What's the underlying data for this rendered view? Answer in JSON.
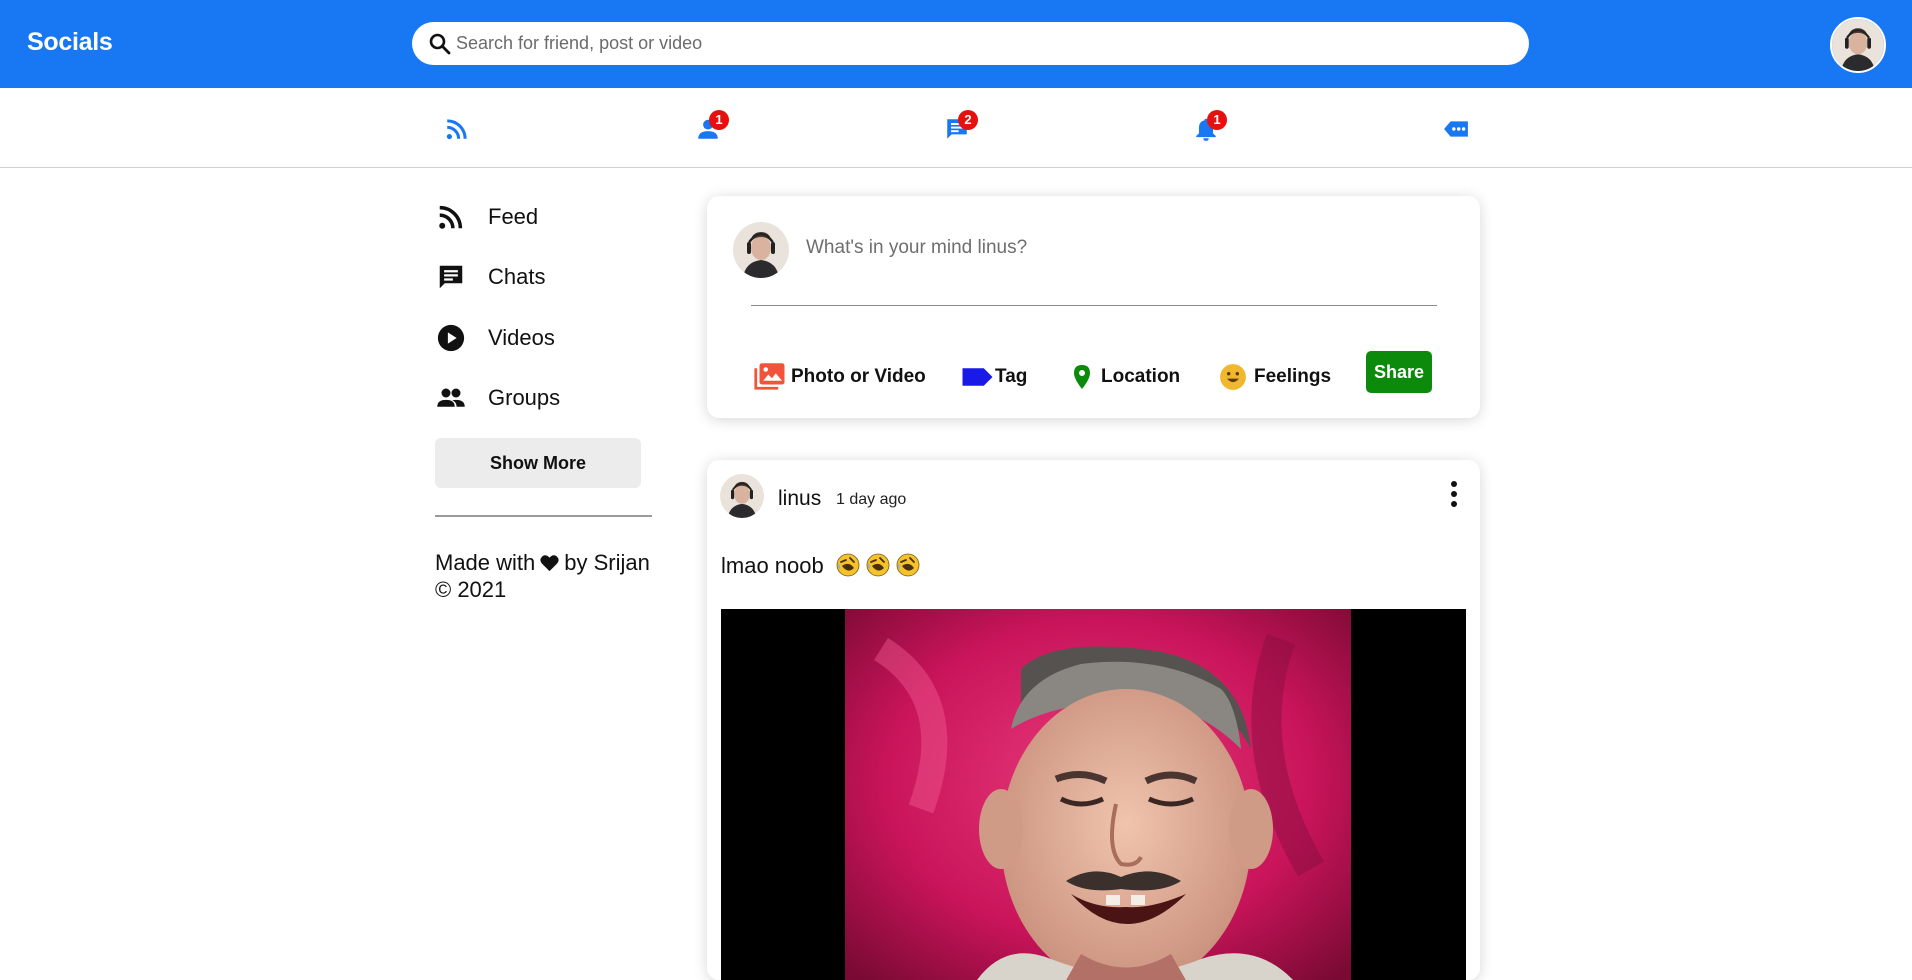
{
  "app": {
    "logo": "Socials"
  },
  "search": {
    "placeholder": "Search for friend, post or video",
    "value": ""
  },
  "nav": {
    "items": [
      {
        "icon": "rss-feed-icon",
        "badge": ""
      },
      {
        "icon": "person-icon",
        "badge": "1"
      },
      {
        "icon": "chat-icon",
        "badge": "2"
      },
      {
        "icon": "notifications-icon",
        "badge": "1"
      },
      {
        "icon": "more-label-icon",
        "badge": ""
      }
    ],
    "accent": "#1877f2",
    "badge_color": "#e4110f"
  },
  "sidebar": {
    "items": [
      {
        "label": "Feed",
        "icon": "rss-feed-icon"
      },
      {
        "label": "Chats",
        "icon": "chat-icon"
      },
      {
        "label": "Videos",
        "icon": "play-circle-icon"
      },
      {
        "label": "Groups",
        "icon": "group-icon"
      }
    ],
    "show_more_label": "Show More",
    "footer_made_with": "Made with",
    "footer_by": "by Srijan",
    "footer_copyright": "© 2021"
  },
  "composer": {
    "placeholder": "What's in your mind linus?",
    "value": "",
    "options": [
      {
        "label": "Photo or Video",
        "icon": "photo-library-icon",
        "color": "#f2533b"
      },
      {
        "label": "Tag",
        "icon": "label-icon",
        "color": "#1a1ae6"
      },
      {
        "label": "Location",
        "icon": "location-pin-icon",
        "color": "#0b8a0b"
      },
      {
        "label": "Feelings",
        "icon": "emoji-smile-icon",
        "color": "#f0b72f"
      }
    ],
    "share_label": "Share",
    "share_color": "#0b8a0b"
  },
  "post": {
    "username": "linus",
    "time": "1 day ago",
    "text": "lmao noob",
    "emojis": [
      "rolling-laughing-emoji",
      "rolling-laughing-emoji",
      "rolling-laughing-emoji"
    ],
    "media": "laughing-man-image"
  }
}
